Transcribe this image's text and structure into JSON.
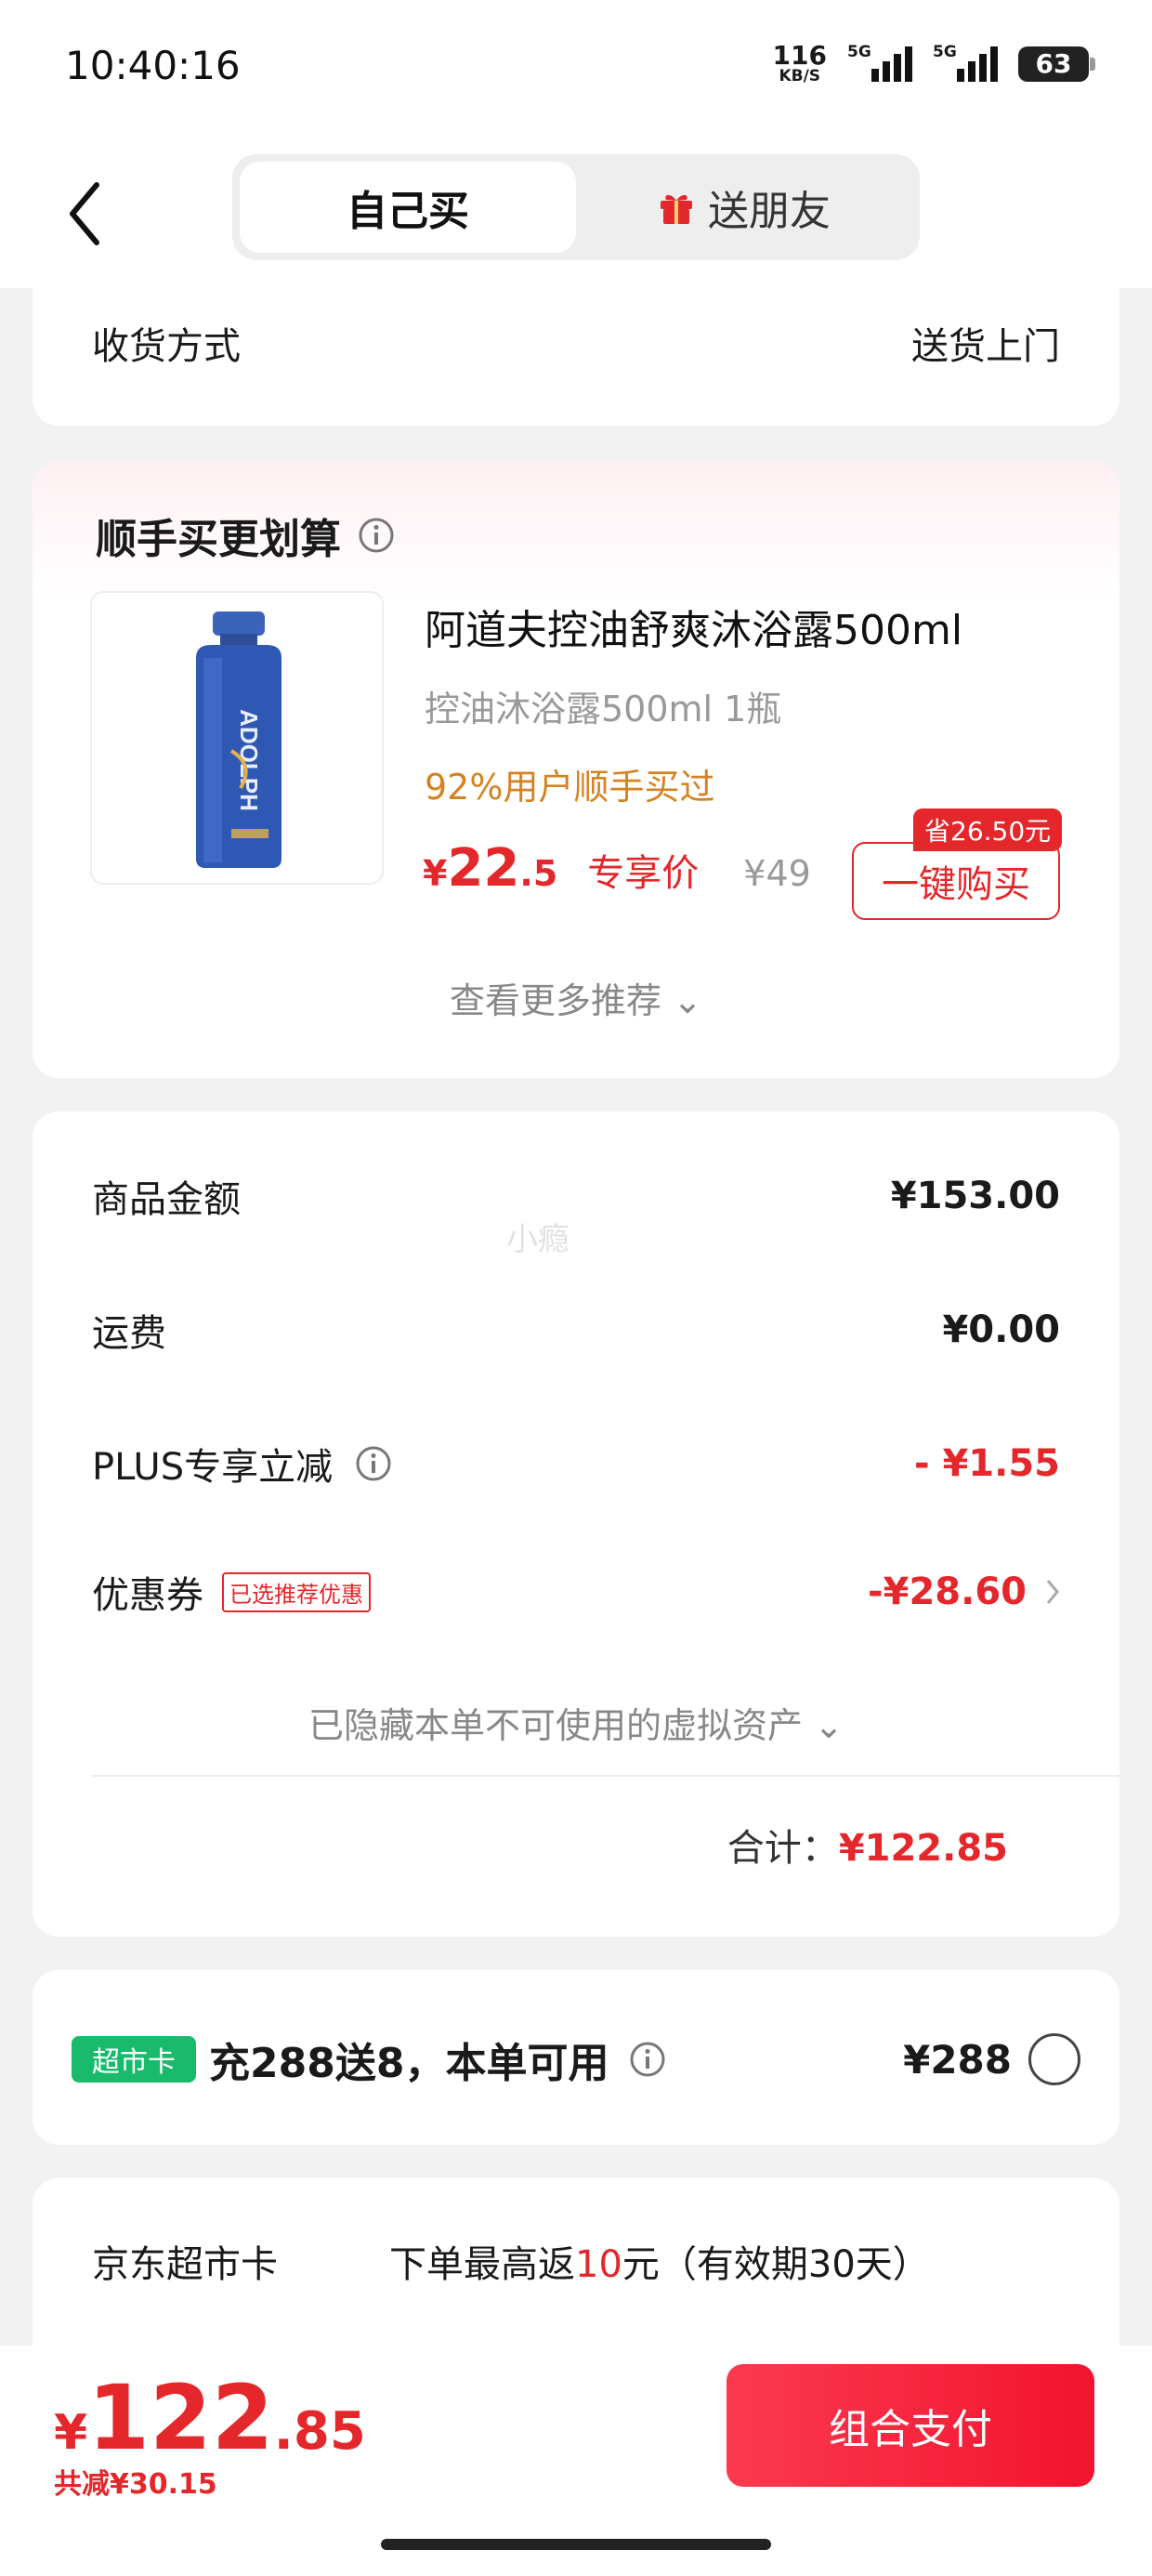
{
  "status": {
    "time": "10:40:16",
    "net_speed": "116",
    "net_unit": "KB/S",
    "signal1_label": "5G",
    "signal2_label": "5G",
    "battery": "63"
  },
  "header": {
    "back_icon": "chevron-left-icon",
    "tab_self": "自己买",
    "tab_gift": "送朋友",
    "gift_icon": "gift-icon"
  },
  "delivery": {
    "label": "收货方式",
    "value": "送货上门"
  },
  "recommend": {
    "title": "顺手买更划算",
    "product_name": "阿道夫控油舒爽沐浴露500ml",
    "product_spec": "控油沐浴露500ml  1瓶",
    "tip": "92%用户顺手买过",
    "price_yen": "¥",
    "price_int": "22",
    "price_dec": ".5",
    "price_label": "专享价",
    "orig_price": "¥49",
    "save_badge": "省26.50元",
    "buy_button": "一键购买",
    "more_link": "查看更多推荐 ⌄",
    "brand_text": "ADOLPH"
  },
  "price_summary": {
    "goods_label": "商品金额",
    "goods_value": "¥153.00",
    "shipping_label": "运费",
    "shipping_value": "¥0.00",
    "plus_label": "PLUS专享立减",
    "plus_value": "- ¥1.55",
    "coupon_label": "优惠券",
    "coupon_tag": "已选推荐优惠",
    "coupon_value": "-¥28.60",
    "hidden_assets": "已隐藏本单不可使用的虚拟资产 ⌄",
    "total_label": "合计：",
    "total_value": "¥122.85",
    "watermark": "小瘾"
  },
  "market_card": {
    "badge": "超市卡",
    "text": "充288送8，本单可用",
    "price": "¥288"
  },
  "jd_card": {
    "label": "京东超市卡",
    "text_prefix": "下单最高返",
    "text_highlight": "10",
    "text_suffix": "元（有效期30天）"
  },
  "bottom": {
    "yen": "¥",
    "total_int": "122",
    "total_dec": ".85",
    "saved": "共减¥30.15",
    "pay_button": "组合支付"
  },
  "colors": {
    "accent_red": "#e4272b",
    "tip_orange": "#d58322",
    "market_green": "#1aba6d"
  }
}
